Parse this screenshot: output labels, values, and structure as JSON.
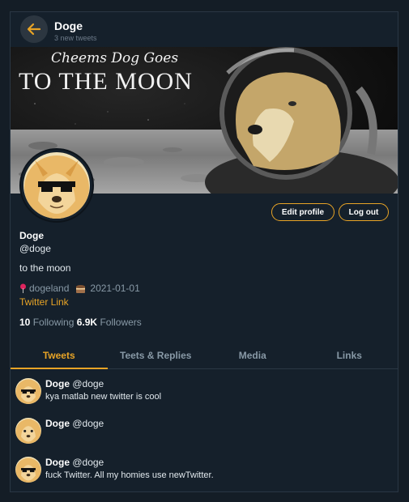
{
  "header": {
    "title": "Doge",
    "subtitle": "3 new tweets"
  },
  "banner": {
    "line1": "Cheems Dog Goes",
    "line2": "TO THE MOON"
  },
  "actions": {
    "edit_label": "Edit profile",
    "logout_label": "Log out"
  },
  "profile": {
    "name": "Doge",
    "handle": "@doge",
    "bio": "to the moon",
    "location": "dogeland",
    "joined": "2021-01-01",
    "link_text": "Twitter Link",
    "following_count": "10",
    "following_label": "Following",
    "followers_count": "6.9K",
    "followers_label": "Followers"
  },
  "tabs": [
    {
      "label": "Tweets",
      "active": true
    },
    {
      "label": "Teets & Replies",
      "active": false
    },
    {
      "label": "Media",
      "active": false
    },
    {
      "label": "Links",
      "active": false
    }
  ],
  "tweets": [
    {
      "name": "Doge",
      "handle": "@doge",
      "text": "kya matlab new twitter is cool"
    },
    {
      "name": "Doge",
      "handle": "@doge",
      "text": ""
    },
    {
      "name": "Doge",
      "handle": "@doge",
      "text": "fuck Twitter. All my homies use newTwitter."
    }
  ],
  "colors": {
    "accent": "#e8a426",
    "background": "#15202b",
    "muted": "#8899a6"
  },
  "icons": {
    "back": "arrow-left-icon",
    "location": "pin-icon",
    "joined": "cake-icon"
  }
}
